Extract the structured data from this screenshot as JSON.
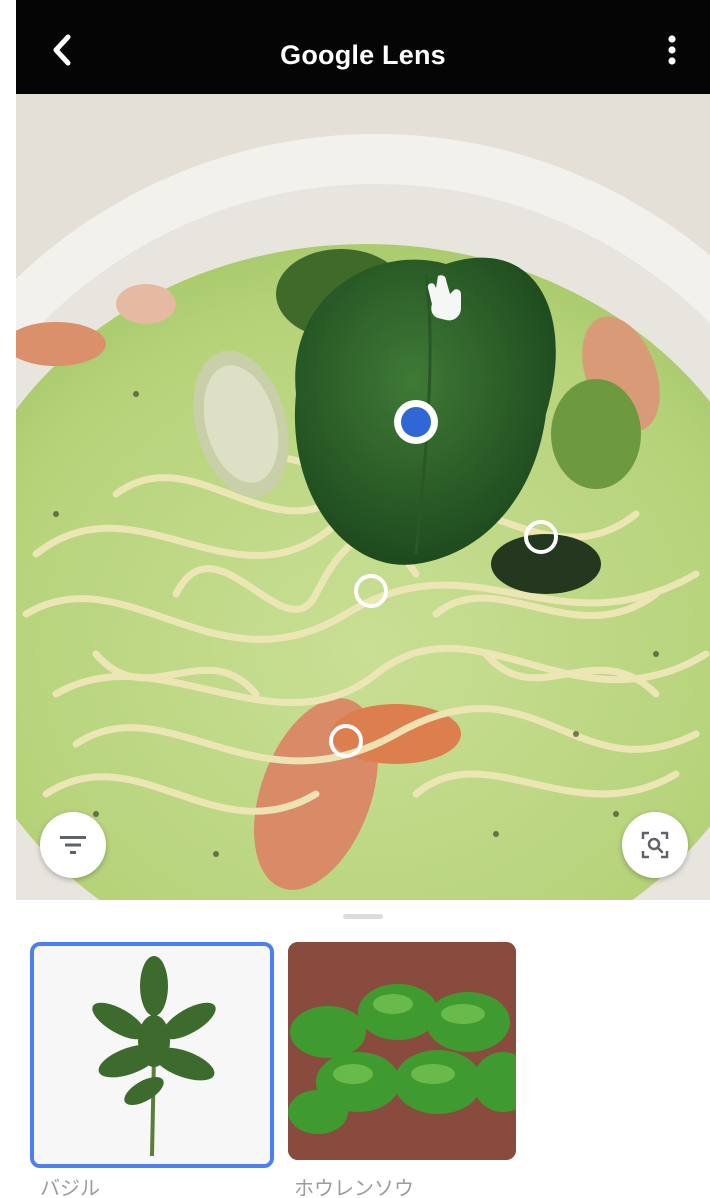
{
  "header": {
    "title": "Google Lens"
  },
  "icons": {
    "back": "chevron-left-icon",
    "more": "more-vert-icon",
    "cursor": "hand-pointer-icon",
    "filter": "filter-icon",
    "search": "image-search-icon"
  },
  "results": [
    {
      "label": "バジル"
    },
    {
      "label": "ホウレンソウ"
    }
  ],
  "colors": {
    "topbar": "#050505",
    "selected_dot": "#2f67d7",
    "selected_border": "#4c7ff1"
  }
}
